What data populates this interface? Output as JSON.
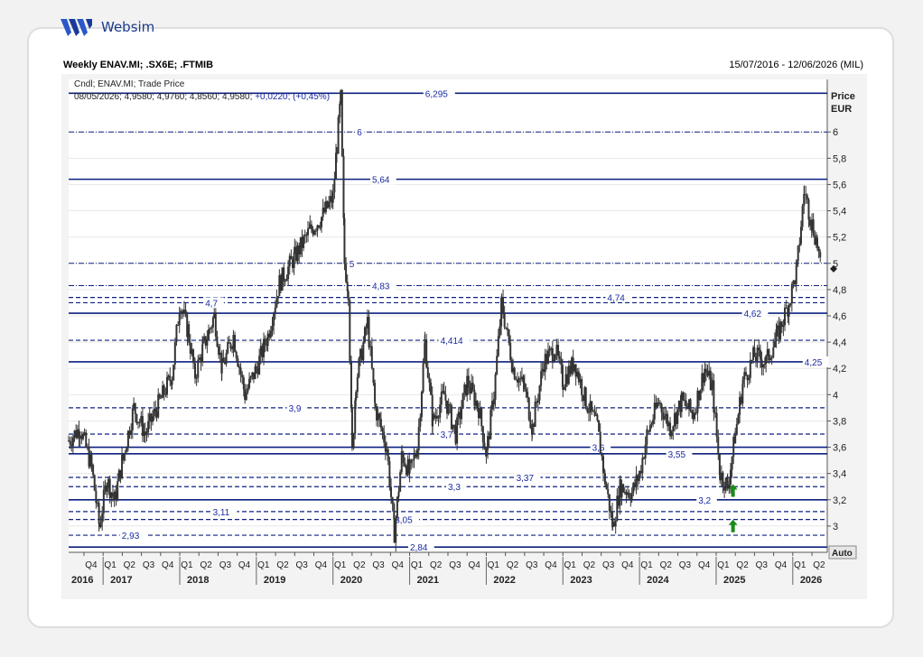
{
  "brand": {
    "name": "Websim"
  },
  "header": {
    "title": "Weekly ENAV.MI; .SX6E; .FTMIB",
    "range": "15/07/2016 - 12/06/2026 (MIL)"
  },
  "chart_data": {
    "type": "candlestick",
    "legend": {
      "line1": "Cndl; ENAV.MI; Trade Price",
      "line2": "08/05/2026; 4,9580; 4,9760; 4,8560; 4,9580;",
      "change": "+0,0220; (+0,45%)"
    },
    "y_axis": {
      "label_line1": "Price",
      "label_line2": "EUR",
      "ylim": [
        2.8,
        6.4
      ],
      "ticks": [
        "3",
        "3,2",
        "3,4",
        "3,6",
        "3,8",
        "4",
        "4,2",
        "4,4",
        "4,6",
        "4,8",
        "5",
        "5,2",
        "5,4",
        "5,6",
        "5,8",
        "6"
      ],
      "auto_button": "Auto",
      "last_price": 4.958
    },
    "x_axis": {
      "quarters": [
        "Q4",
        "Q1",
        "Q2",
        "Q3",
        "Q4",
        "Q1",
        "Q2",
        "Q3",
        "Q4",
        "Q1",
        "Q2",
        "Q3",
        "Q4",
        "Q1",
        "Q2",
        "Q3",
        "Q4",
        "Q1",
        "Q2",
        "Q3",
        "Q4",
        "Q1",
        "Q2",
        "Q3",
        "Q4",
        "Q1",
        "Q2",
        "Q3",
        "Q4",
        "Q1",
        "Q2",
        "Q3",
        "Q4",
        "Q1",
        "Q2",
        "Q3",
        "Q4",
        "Q1",
        "Q2"
      ],
      "years": [
        "2016",
        "2017",
        "2018",
        "2019",
        "2020",
        "2021",
        "2022",
        "2023",
        "2024",
        "2025",
        "2026"
      ]
    },
    "levels": [
      {
        "value": 6.295,
        "label": "6,295",
        "style": "solid",
        "label_pos": 0.47
      },
      {
        "value": 6.0,
        "label": "6",
        "style": "dashdot",
        "label_pos": 0.38
      },
      {
        "value": 5.64,
        "label": "5,64",
        "style": "solid",
        "label_pos": 0.4
      },
      {
        "value": 5.0,
        "label": "5",
        "style": "dashdot",
        "label_pos": 0.37
      },
      {
        "value": 4.83,
        "label": "4,83",
        "style": "dashdot",
        "label_pos": 0.4
      },
      {
        "value": 4.74,
        "label": "4,74",
        "style": "dashed",
        "label_pos": 0.71
      },
      {
        "value": 4.7,
        "label": "4,7",
        "style": "dashed",
        "label_pos": 0.18
      },
      {
        "value": 4.62,
        "label": "4,62",
        "style": "solid",
        "label_pos": 0.89
      },
      {
        "value": 4.414,
        "label": "4,414",
        "style": "dashed",
        "label_pos": 0.49
      },
      {
        "value": 4.25,
        "label": "4,25",
        "style": "solid",
        "label_pos": 0.97
      },
      {
        "value": 3.9,
        "label": "3,9",
        "style": "dashed",
        "label_pos": 0.29
      },
      {
        "value": 3.7,
        "label": "3,7",
        "style": "dashed",
        "label_pos": 0.49
      },
      {
        "value": 3.6,
        "label": "3,6",
        "style": "solid",
        "label_pos": 0.69
      },
      {
        "value": 3.55,
        "label": "3,55",
        "style": "solid",
        "label_pos": 0.79
      },
      {
        "value": 3.37,
        "label": "3,37",
        "style": "dashed",
        "label_pos": 0.59
      },
      {
        "value": 3.3,
        "label": "3,3",
        "style": "dashed",
        "label_pos": 0.5
      },
      {
        "value": 3.2,
        "label": "3,2",
        "style": "solid",
        "label_pos": 0.83
      },
      {
        "value": 3.11,
        "label": "3,11",
        "style": "dashed",
        "label_pos": 0.19
      },
      {
        "value": 3.05,
        "label": "3,05",
        "style": "dashed",
        "label_pos": 0.43
      },
      {
        "value": 2.93,
        "label": "2,93",
        "style": "dashed",
        "label_pos": 0.07
      },
      {
        "value": 2.84,
        "label": "2,84",
        "style": "solid",
        "label_pos": 0.45
      }
    ],
    "price_path": [
      [
        2016.55,
        3.65
      ],
      [
        2016.7,
        3.75
      ],
      [
        2016.85,
        3.45
      ],
      [
        2016.95,
        3.0
      ],
      [
        2017.05,
        3.35
      ],
      [
        2017.15,
        3.2
      ],
      [
        2017.25,
        3.5
      ],
      [
        2017.4,
        3.9
      ],
      [
        2017.55,
        3.7
      ],
      [
        2017.7,
        3.9
      ],
      [
        2017.9,
        4.15
      ],
      [
        2018.0,
        4.7
      ],
      [
        2018.1,
        4.5
      ],
      [
        2018.2,
        4.15
      ],
      [
        2018.3,
        4.35
      ],
      [
        2018.45,
        4.6
      ],
      [
        2018.55,
        4.2
      ],
      [
        2018.7,
        4.45
      ],
      [
        2018.85,
        4.0
      ],
      [
        2019.0,
        4.2
      ],
      [
        2019.15,
        4.45
      ],
      [
        2019.3,
        4.85
      ],
      [
        2019.5,
        5.05
      ],
      [
        2019.7,
        5.25
      ],
      [
        2019.85,
        5.35
      ],
      [
        2020.0,
        5.5
      ],
      [
        2020.05,
        5.9
      ],
      [
        2020.1,
        6.25
      ],
      [
        2020.15,
        5.0
      ],
      [
        2020.2,
        4.8
      ],
      [
        2020.25,
        3.55
      ],
      [
        2020.3,
        4.1
      ],
      [
        2020.45,
        4.55
      ],
      [
        2020.55,
        3.9
      ],
      [
        2020.7,
        3.6
      ],
      [
        2020.8,
        2.95
      ],
      [
        2020.9,
        3.55
      ],
      [
        2021.0,
        3.4
      ],
      [
        2021.1,
        3.6
      ],
      [
        2021.2,
        4.4
      ],
      [
        2021.3,
        3.8
      ],
      [
        2021.45,
        4.0
      ],
      [
        2021.6,
        3.7
      ],
      [
        2021.75,
        4.1
      ],
      [
        2021.9,
        3.9
      ],
      [
        2022.0,
        3.55
      ],
      [
        2022.1,
        4.0
      ],
      [
        2022.2,
        4.7
      ],
      [
        2022.35,
        4.2
      ],
      [
        2022.5,
        4.05
      ],
      [
        2022.6,
        3.75
      ],
      [
        2022.75,
        4.25
      ],
      [
        2022.9,
        4.35
      ],
      [
        2023.0,
        4.1
      ],
      [
        2023.15,
        4.25
      ],
      [
        2023.3,
        3.95
      ],
      [
        2023.45,
        3.75
      ],
      [
        2023.55,
        3.35
      ],
      [
        2023.65,
        3.0
      ],
      [
        2023.75,
        3.3
      ],
      [
        2023.9,
        3.25
      ],
      [
        2024.0,
        3.4
      ],
      [
        2024.1,
        3.7
      ],
      [
        2024.25,
        3.95
      ],
      [
        2024.4,
        3.75
      ],
      [
        2024.55,
        3.95
      ],
      [
        2024.7,
        3.85
      ],
      [
        2024.85,
        4.2
      ],
      [
        2024.95,
        4.05
      ],
      [
        2025.05,
        3.4
      ],
      [
        2025.15,
        3.3
      ],
      [
        2025.25,
        3.7
      ],
      [
        2025.35,
        4.1
      ],
      [
        2025.5,
        4.3
      ],
      [
        2025.65,
        4.25
      ],
      [
        2025.8,
        4.45
      ],
      [
        2025.95,
        4.7
      ],
      [
        2026.05,
        4.95
      ],
      [
        2026.15,
        5.55
      ],
      [
        2026.25,
        5.3
      ],
      [
        2026.32,
        5.15
      ],
      [
        2026.36,
        4.96
      ]
    ],
    "markers": [
      {
        "type": "up-arrow",
        "x": 2025.22,
        "y": 3.25,
        "color": "#1a8a1a"
      },
      {
        "type": "up-arrow",
        "x": 2025.22,
        "y": 2.98,
        "color": "#1a8a1a"
      }
    ],
    "colors": {
      "levels": "#0d2080",
      "candles": "#333333",
      "label_text": "#1a2aa0",
      "plot_bg": "#ffffff"
    }
  }
}
